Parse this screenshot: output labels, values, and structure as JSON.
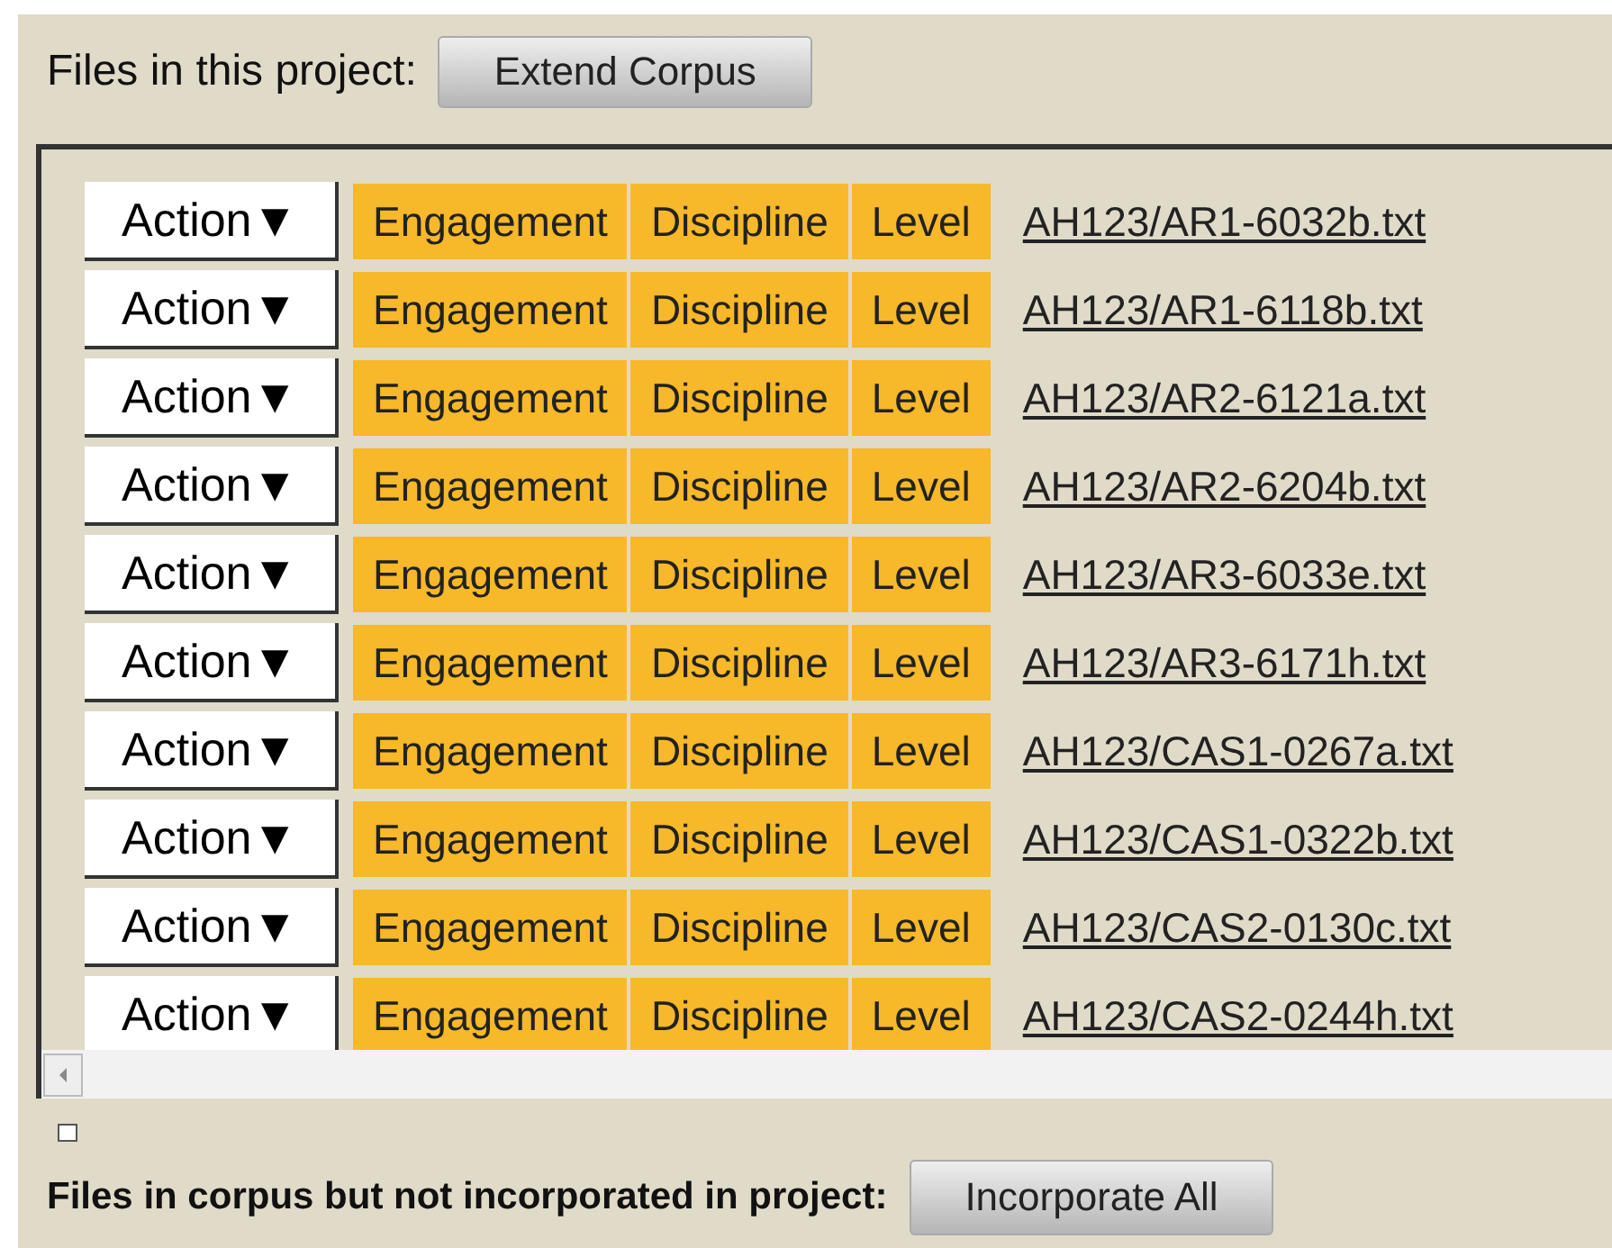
{
  "project_header": {
    "label": "Files in this project:",
    "button": "Extend Corpus"
  },
  "files": [
    {
      "action": "Action▼",
      "tags": [
        "Engagement",
        "Discipline",
        "Level"
      ],
      "file": "AH123/AR1-6032b.txt"
    },
    {
      "action": "Action▼",
      "tags": [
        "Engagement",
        "Discipline",
        "Level"
      ],
      "file": "AH123/AR1-6118b.txt"
    },
    {
      "action": "Action▼",
      "tags": [
        "Engagement",
        "Discipline",
        "Level"
      ],
      "file": "AH123/AR2-6121a.txt"
    },
    {
      "action": "Action▼",
      "tags": [
        "Engagement",
        "Discipline",
        "Level"
      ],
      "file": "AH123/AR2-6204b.txt"
    },
    {
      "action": "Action▼",
      "tags": [
        "Engagement",
        "Discipline",
        "Level"
      ],
      "file": "AH123/AR3-6033e.txt"
    },
    {
      "action": "Action▼",
      "tags": [
        "Engagement",
        "Discipline",
        "Level"
      ],
      "file": "AH123/AR3-6171h.txt"
    },
    {
      "action": "Action▼",
      "tags": [
        "Engagement",
        "Discipline",
        "Level"
      ],
      "file": "AH123/CAS1-0267a.txt"
    },
    {
      "action": "Action▼",
      "tags": [
        "Engagement",
        "Discipline",
        "Level"
      ],
      "file": "AH123/CAS1-0322b.txt"
    },
    {
      "action": "Action▼",
      "tags": [
        "Engagement",
        "Discipline",
        "Level"
      ],
      "file": "AH123/CAS2-0130c.txt"
    },
    {
      "action": "Action▼",
      "tags": [
        "Engagement",
        "Discipline",
        "Level"
      ],
      "file": "AH123/CAS2-0244h.txt"
    }
  ],
  "corpus_footer": {
    "checked": false,
    "label": "Files in corpus but not incorporated in project:",
    "button": "Incorporate All"
  }
}
